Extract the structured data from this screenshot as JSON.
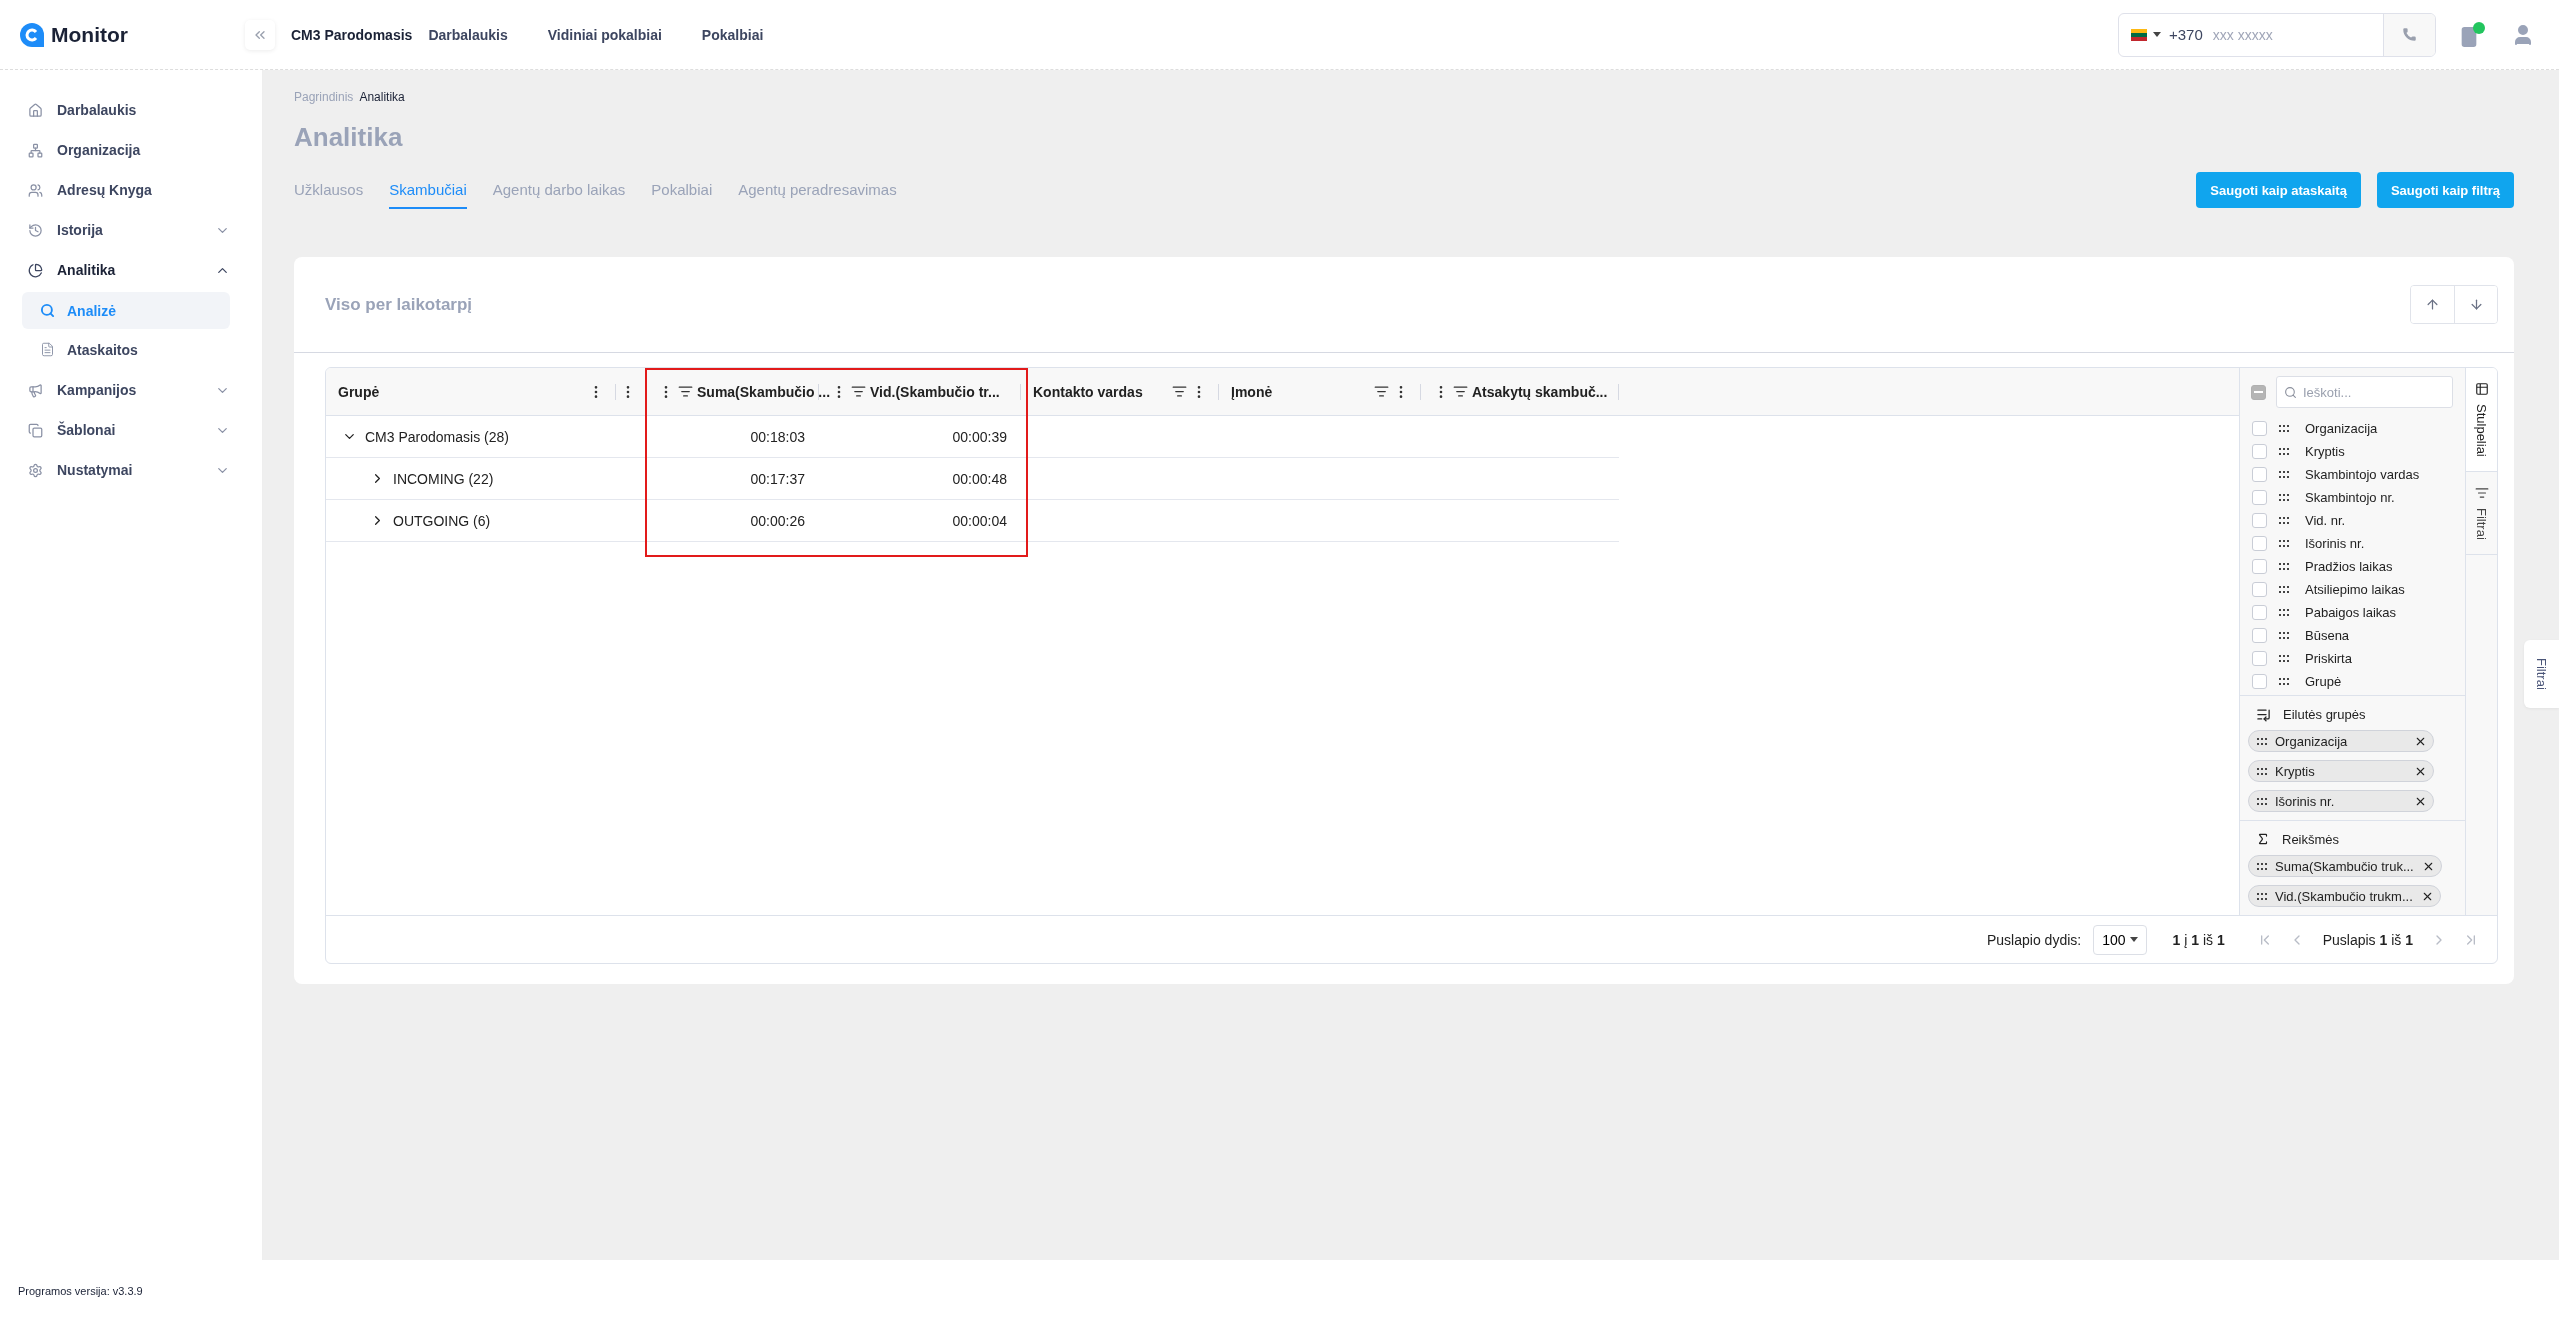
{
  "app": {
    "logo": "Monitor"
  },
  "topnav": {
    "company": "CM3 Parodomasis",
    "links": [
      "Darbalaukis",
      "Vidiniai pokalbiai",
      "Pokalbiai"
    ]
  },
  "phone": {
    "prefix": "+370",
    "placeholder": "xxx xxxxx"
  },
  "sidebar": {
    "items": [
      {
        "label": "Darbalaukis",
        "selected": false
      },
      {
        "label": "Organizacija",
        "selected": false
      },
      {
        "label": "Adresų Knyga",
        "selected": false
      },
      {
        "label": "Istorija",
        "selected": false,
        "expanded": false
      },
      {
        "label": "Analitika",
        "selected": true,
        "expanded": true,
        "children": [
          {
            "label": "Analizė",
            "selected": true
          },
          {
            "label": "Ataskaitos",
            "selected": false
          }
        ]
      },
      {
        "label": "Kampanijos",
        "selected": false,
        "expanded": false
      },
      {
        "label": "Šablonai",
        "selected": false,
        "expanded": false
      },
      {
        "label": "Nustatymai",
        "selected": false,
        "expanded": false
      }
    ]
  },
  "breadcrumb": [
    "Pagrindinis",
    "Analitika"
  ],
  "page_title": "Analitika",
  "tabs": [
    {
      "label": "Užklausos",
      "selected": false
    },
    {
      "label": "Skambučiai",
      "selected": true
    },
    {
      "label": "Agentų darbo laikas",
      "selected": false
    },
    {
      "label": "Pokalbiai",
      "selected": false
    },
    {
      "label": "Agentų peradresavimas",
      "selected": false
    }
  ],
  "actions": [
    "Saugoti kaip ataskaitą",
    "Saugoti kaip filtrą"
  ],
  "card": {
    "title": "Viso per laikotarpį"
  },
  "grid": {
    "columns": [
      {
        "label": "Grupė",
        "kind": "group"
      },
      {
        "kind": "spacer"
      },
      {
        "label": "Suma(Skambučio ...",
        "kind": "value"
      },
      {
        "label": "Vid.(Skambučio tr...",
        "kind": "value"
      },
      {
        "label": "Kontakto vardas",
        "kind": "field"
      },
      {
        "label": "Įmonė",
        "kind": "field"
      },
      {
        "label": "Atsakytų skambuč...",
        "kind": "value"
      }
    ],
    "rows": [
      {
        "label": "CM3 Parodomasis (28)",
        "expanded": true,
        "values": [
          "00:18:03",
          "00:00:39"
        ],
        "children": [
          {
            "label": "INCOMING (22)",
            "expanded": false,
            "values": [
              "00:17:37",
              "00:00:48"
            ]
          },
          {
            "label": "OUTGOING (6)",
            "expanded": false,
            "values": [
              "00:00:26",
              "00:00:04"
            ]
          }
        ]
      }
    ],
    "highlight": true
  },
  "column_panel": {
    "select_all": {
      "indeterminate": true
    },
    "search_placeholder": "Ieškoti...",
    "columns": [
      {
        "label": "Organizacija",
        "checked": false
      },
      {
        "label": "Kryptis",
        "checked": false
      },
      {
        "label": "Skambintojo vardas",
        "checked": false
      },
      {
        "label": "Skambintojo nr.",
        "checked": false
      },
      {
        "label": "Vid. nr.",
        "checked": false
      },
      {
        "label": "Išorinis nr.",
        "checked": false
      },
      {
        "label": "Pradžios laikas",
        "checked": false
      },
      {
        "label": "Atsiliepimo laikas",
        "checked": false
      },
      {
        "label": "Pabaigos laikas",
        "checked": false
      },
      {
        "label": "Būsena",
        "checked": false
      },
      {
        "label": "Priskirta",
        "checked": false
      },
      {
        "label": "Grupė",
        "checked": false
      }
    ],
    "row_groups": {
      "title": "Eilutės grupės",
      "chips": [
        "Organizacija",
        "Kryptis",
        "Išorinis nr."
      ]
    },
    "values": {
      "title": "Reikšmės",
      "chips": [
        "Suma(Skambučio truk...",
        "Vid.(Skambučio trukm..."
      ]
    }
  },
  "side_tabs": [
    {
      "label": "Stulpeliai",
      "selected": true
    },
    {
      "label": "Filtrai",
      "selected": false
    }
  ],
  "pagination": {
    "page_size_label": "Puslapio dydis:",
    "page_size": "100",
    "summary": "**1** į **1** iš **1**",
    "page": "Puslapis **1** iš **1**"
  },
  "floating_tab": "Filtrai",
  "version": "Programos versija: v3.3.9"
}
